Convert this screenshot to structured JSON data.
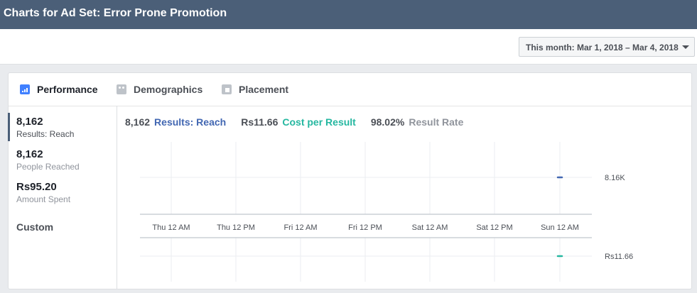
{
  "title": "Charts for Ad Set: Error Prone Promotion",
  "date_range": {
    "label": "This month: Mar 1, 2018 – Mar 4, 2018"
  },
  "tabs": [
    {
      "label": "Performance",
      "icon": "performance-icon",
      "active": true
    },
    {
      "label": "Demographics",
      "icon": "demographics-icon",
      "active": false
    },
    {
      "label": "Placement",
      "icon": "placement-icon",
      "active": false
    }
  ],
  "metrics": [
    {
      "value": "8,162",
      "label": "Results: Reach",
      "active": true
    },
    {
      "value": "8,162",
      "label": "People Reached",
      "active": false
    },
    {
      "value": "Rs95.20",
      "label": "Amount Spent",
      "active": false
    }
  ],
  "custom_label": "Custom",
  "summary": {
    "results_value": "8,162",
    "results_label": "Results: Reach",
    "cost_value": "Rs11.66",
    "cost_label": "Cost per Result",
    "rate_value": "98.02%",
    "rate_label": "Result Rate"
  },
  "colors": {
    "accent_blue": "#4267b2",
    "accent_teal": "#25b7a0",
    "titlebar": "#4b5f78"
  },
  "chart_data": {
    "type": "line",
    "x": [
      "Thu 12 AM",
      "Thu 12 PM",
      "Fri 12 AM",
      "Fri 12 PM",
      "Sat 12 AM",
      "Sat 12 PM",
      "Sun 12 AM"
    ],
    "series": [
      {
        "name": "Results: Reach",
        "values": [
          null,
          null,
          null,
          null,
          null,
          null,
          8160
        ],
        "color": "#4267b2"
      },
      {
        "name": "Cost per Result",
        "values": [
          null,
          null,
          null,
          null,
          null,
          null,
          11.66
        ],
        "color": "#25b7a0"
      }
    ],
    "ticks": {
      "reach": "8.16K",
      "cost": "Rs11.66"
    }
  }
}
